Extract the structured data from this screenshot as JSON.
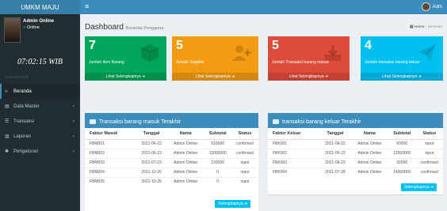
{
  "app": {
    "logo": "UMKM MAJU",
    "menu_icon": "hamburger-icon"
  },
  "topbar": {
    "user_name": "Adm"
  },
  "sidebar": {
    "user": {
      "name": "Admin Online",
      "status": "Online"
    },
    "clock": "07:02:15 WIB",
    "nav_header": "NAVIGATION",
    "items": [
      {
        "label": "Beranda",
        "icon": "home-icon",
        "has_children": false
      },
      {
        "label": "Data Master",
        "icon": "database-icon",
        "has_children": true
      },
      {
        "label": "Transaksi",
        "icon": "list-icon",
        "has_children": true
      },
      {
        "label": "Laporan",
        "icon": "chart-icon",
        "has_children": true
      },
      {
        "label": "Pengaturan",
        "icon": "gears-icon",
        "has_children": true
      }
    ]
  },
  "page": {
    "title": "Dashboard",
    "subtitle": "Beranda Pengguna",
    "breadcrumb": {
      "home": "Home",
      "current": "Beranda"
    }
  },
  "stats": [
    {
      "value": "7",
      "label": "Jumlah Item Barang",
      "link": "Lihat Selengkapnya",
      "color": "#00a65a",
      "icon": "cube-icon"
    },
    {
      "value": "5",
      "label": "Jumlah Supplier",
      "link": "Lihat Selengkapnya",
      "color": "#f39c12",
      "icon": "user-plus-icon"
    },
    {
      "value": "5",
      "label": "Jumlah Transaksi barang masuk",
      "link": "Lihat Selengkapnya",
      "color": "#dd4b39",
      "icon": "download-icon"
    },
    {
      "value": "4",
      "label": "Jumlah transaksi barang keluar",
      "link": "Lihat Selengkapnya",
      "color": "#00c0ef",
      "icon": "paper-plane-icon"
    }
  ],
  "masuk": {
    "title": "Transaksi barang masuk Terakhir",
    "columns": [
      "Faktur Masuk",
      "Tanggal",
      "Nama",
      "Subtotal",
      "Status"
    ],
    "rows": [
      [
        "FBM001",
        "2021-06-22",
        "Admin Online",
        "516000",
        "confirmed"
      ],
      [
        "FBM002",
        "2021-06-23",
        "Admin Online",
        "12000000",
        "confirmed"
      ],
      [
        "FBM003",
        "2021-07-23",
        "Admin Online",
        "120000",
        "input"
      ],
      [
        "FBM004",
        "2021-10-26",
        "Admin Online",
        "0",
        "input"
      ],
      [
        "FBM005",
        "2021-10-26",
        "Admin Online",
        "0",
        "input"
      ]
    ],
    "button": "Selengkapnya"
  },
  "keluar": {
    "title": "transaksi barang keluar Terakhir",
    "columns": [
      "Faktur Keluar",
      "Tanggal",
      "Nama",
      "Subtotal",
      "Status"
    ],
    "rows": [
      [
        "FBK001",
        "2021-06-22",
        "Admin Online",
        "60000",
        "input"
      ],
      [
        "FBK002",
        "2021-06-23",
        "Admin Online",
        "12000000",
        "input"
      ],
      [
        "FBK003",
        "2021-06-23",
        "Admin Online",
        "92000",
        "confirmed"
      ],
      [
        "FBK004",
        "2021-07-28",
        "Admin Online",
        "14000000",
        "confirmed"
      ]
    ],
    "button": "Selengkapnya"
  }
}
